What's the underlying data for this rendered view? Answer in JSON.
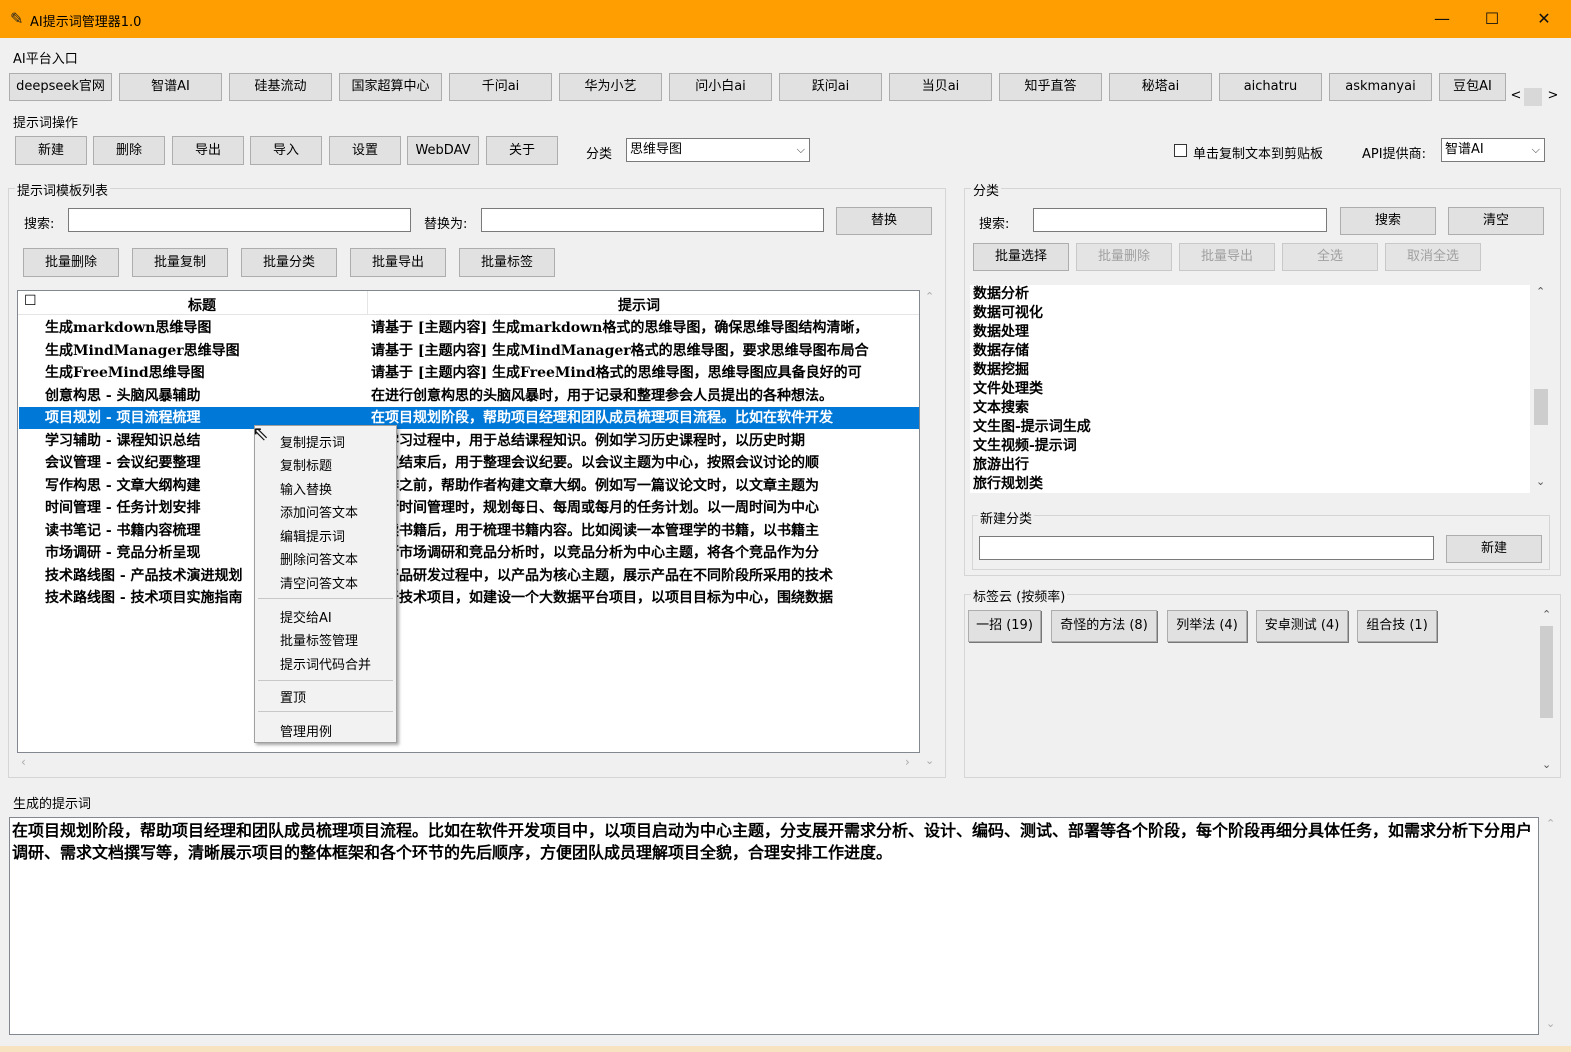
{
  "window": {
    "title": "AI提示词管理器1.0",
    "minimize": "—",
    "maximize": "☐",
    "close": "✕"
  },
  "platforms": {
    "group_label": "AI平台入口",
    "buttons": [
      "deepseek官网",
      "智谱AI",
      "硅基流动",
      "国家超算中心",
      "千问ai",
      "华为小艺",
      "问小白ai",
      "跃问ai",
      "当贝ai",
      "知乎直答",
      "秘塔ai",
      "aichatru",
      "askmanyai",
      "豆包AI"
    ],
    "scroll_left": "<",
    "scroll_right": ">"
  },
  "ops": {
    "group_label": "提示词操作",
    "buttons": [
      "新建",
      "删除",
      "导出",
      "导入",
      "设置",
      "WebDAV",
      "关于"
    ],
    "category_label": "分类",
    "category_value": "思维导图",
    "copy_checkbox_label": "单击复制文本到剪贴板",
    "api_label": "API提供商:",
    "api_value": "智谱AI"
  },
  "templates": {
    "group_label": "提示词模板列表",
    "search_label": "搜索:",
    "replace_label": "替换为:",
    "replace_button": "替换",
    "batch_buttons": [
      "批量删除",
      "批量复制",
      "批量分类",
      "批量导出",
      "批量标签"
    ],
    "columns": [
      "标题",
      "提示词"
    ],
    "header_check": "☐",
    "rows": [
      {
        "title": "生成markdown思维导图",
        "prompt": "请基于 [主题内容] 生成markdown格式的思维导图，确保思维导图结构清晰，"
      },
      {
        "title": "生成MindManager思维导图",
        "prompt": "请基于 [主题内容] 生成MindManager格式的思维导图，要求思维导图布局合"
      },
      {
        "title": "生成FreeMind思维导图",
        "prompt": "请基于 [主题内容] 生成FreeMind格式的思维导图，思维导图应具备良好的可"
      },
      {
        "title": "创意构思 - 头脑风暴辅助",
        "prompt": "在进行创意构思的头脑风暴时，用于记录和整理参会人员提出的各种想法。"
      },
      {
        "title": "项目规划 - 项目流程梳理",
        "prompt": "在项目规划阶段，帮助项目经理和团队成员梳理项目流程。比如在软件开发"
      },
      {
        "title": "学习辅助 - 课程知识总结",
        "prompt": "在学习过程中，用于总结课程知识。例如学习历史课程时，以历史时期"
      },
      {
        "title": "会议管理 - 会议纪要整理",
        "prompt": "会议结束后，用于整理会议纪要。以会议主题为中心，按照会议讨论的顺"
      },
      {
        "title": "写作构思 - 文章大纲构建",
        "prompt": "写作之前，帮助作者构建文章大纲。例如写一篇议论文时，以文章主题为"
      },
      {
        "title": "时间管理 - 任务计划安排",
        "prompt": "进行时间管理时，规划每日、每周或每月的任务计划。以一周时间为中心"
      },
      {
        "title": "读书笔记 - 书籍内容梳理",
        "prompt": "阅读书籍后，用于梳理书籍内容。比如阅读一本管理学的书籍，以书籍主"
      },
      {
        "title": "市场调研 - 竞品分析呈现",
        "prompt": "进行市场调研和竞品分析时，以竞品分析为中心主题，将各个竞品作为分"
      },
      {
        "title": "技术路线图 - 产品技术演进规划",
        "prompt": "在产品研发过程中，以产品为核心主题，展示产品在不同阶段所采用的技术"
      },
      {
        "title": "技术路线图 - 技术项目实施指南",
        "prompt": "对于技术项目，如建设一个大数据平台项目，以项目目标为中心，围绕数据"
      }
    ],
    "selected_index": 4
  },
  "context_menu": {
    "items": [
      "复制提示词",
      "复制标题",
      "输入替换",
      "添加问答文本",
      "编辑提示词",
      "删除问答文本",
      "清空问答文本",
      "提交给AI",
      "批量标签管理",
      "提示词代码合并",
      "置顶",
      "管理用例"
    ]
  },
  "category_panel": {
    "group_label": "分类",
    "search_label": "搜索:",
    "search_button": "搜索",
    "clear_button": "清空",
    "batch_buttons": [
      "批量选择",
      "批量删除",
      "批量导出",
      "全选",
      "取消全选"
    ],
    "items": [
      "数据分析",
      "数据可视化",
      "数据处理",
      "数据存储",
      "数据挖掘",
      "文件处理类",
      "文本搜索",
      "文生图-提示词生成",
      "文生视频-提示词",
      "旅游出行",
      "旅行规划类"
    ],
    "new_group_label": "新建分类",
    "new_button": "新建"
  },
  "tag_cloud": {
    "group_label": "标签云 (按频率)",
    "tags": [
      "一招 (19)",
      "奇怪的方法 (8)",
      "列举法 (4)",
      "安卓测试 (4)",
      "组合技 (1)"
    ]
  },
  "output": {
    "group_label": "生成的提示词",
    "text": "在项目规划阶段，帮助项目经理和团队成员梳理项目流程。比如在软件开发项目中，以项目启动为中心主题，分支展开需求分析、设计、编码、测试、部署等各个阶段，每个阶段再细分具体任务，如需求分析下分用户调研、需求文档撰写等，清晰展示项目的整体框架和各个环节的先后顺序，方便团队成员理解项目全貌，合理安排工作进度。"
  }
}
